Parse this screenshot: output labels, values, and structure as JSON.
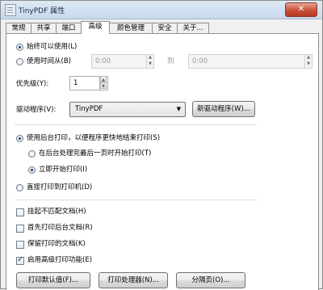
{
  "window": {
    "title": "TinyPDF 属性",
    "close_glyph": "✕"
  },
  "tabs": [
    {
      "label": "常规"
    },
    {
      "label": "共享"
    },
    {
      "label": "端口"
    },
    {
      "label": "高级"
    },
    {
      "label": "颜色管理"
    },
    {
      "label": "安全"
    },
    {
      "label": "关于..."
    }
  ],
  "availability": {
    "always_label": "始终可以使用(L)",
    "from_label": "使用时间从(B)",
    "time_from": "0:00",
    "to_label": "到",
    "time_to": "0:00"
  },
  "priority": {
    "label": "优先级(Y):",
    "value": "1"
  },
  "driver": {
    "label": "驱动程序(V):",
    "selected": "TinyPDF",
    "new_driver_label": "新驱动程序(W)..."
  },
  "spooling": {
    "spool_label": "使用后台打印，以便程序更快地结束打印(S)",
    "after_last_page_label": "在后台处理完最后一页时开始打印(T)",
    "immediately_label": "立即开始打印(I)",
    "direct_label": "直接打印到打印机(D)"
  },
  "options": [
    {
      "label": "挂起不匹配文档(H)",
      "checked": false
    },
    {
      "label": "首先打印后台文档(R)",
      "checked": false
    },
    {
      "label": "保留打印的文档(K)",
      "checked": false
    },
    {
      "label": "启用高级打印功能(E)",
      "checked": true
    }
  ],
  "buttons": {
    "defaults_label": "打印默认值(F)...",
    "processor_label": "打印处理器(N)...",
    "separator_label": "分隔页(O)..."
  },
  "icons": {
    "app": "document-icon",
    "dropdown": "chevron-down-icon"
  }
}
